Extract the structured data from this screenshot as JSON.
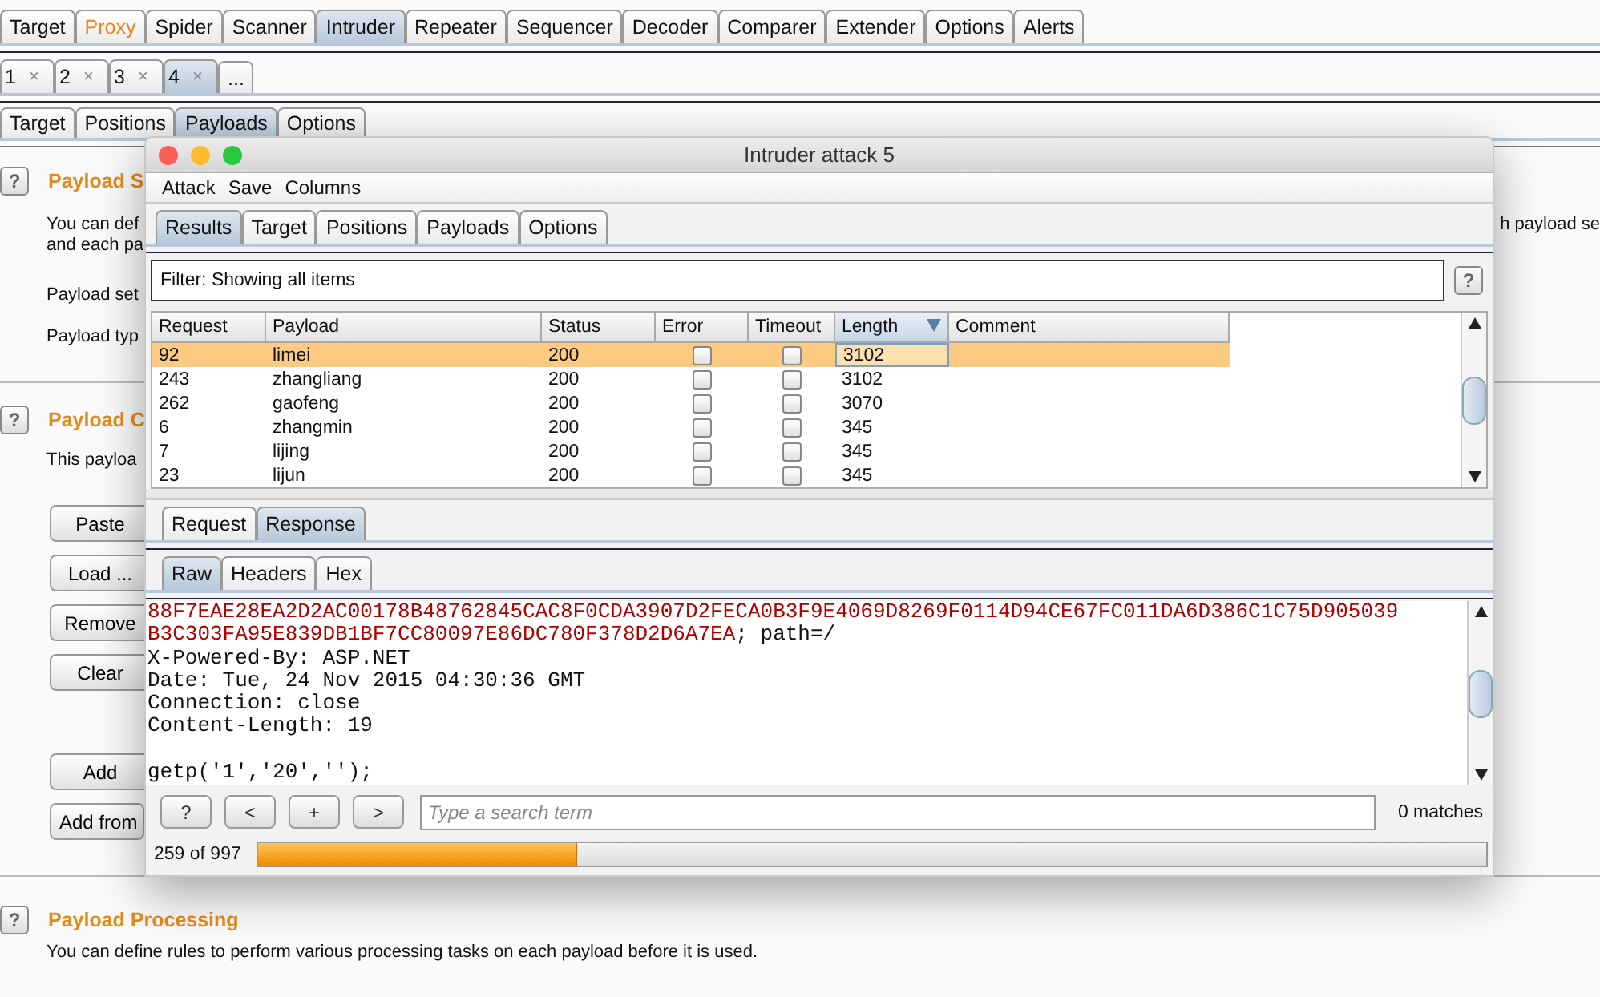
{
  "main_tabs": [
    {
      "label": "Target",
      "selected": false,
      "highlighted": false
    },
    {
      "label": "Proxy",
      "selected": false,
      "highlighted": true
    },
    {
      "label": "Spider",
      "selected": false,
      "highlighted": false
    },
    {
      "label": "Scanner",
      "selected": false,
      "highlighted": false
    },
    {
      "label": "Intruder",
      "selected": true,
      "highlighted": false
    },
    {
      "label": "Repeater",
      "selected": false,
      "highlighted": false
    },
    {
      "label": "Sequencer",
      "selected": false,
      "highlighted": false
    },
    {
      "label": "Decoder",
      "selected": false,
      "highlighted": false
    },
    {
      "label": "Comparer",
      "selected": false,
      "highlighted": false
    },
    {
      "label": "Extender",
      "selected": false,
      "highlighted": false
    },
    {
      "label": "Options",
      "selected": false,
      "highlighted": false
    },
    {
      "label": "Alerts",
      "selected": false,
      "highlighted": false
    }
  ],
  "attack_tabs": [
    {
      "label": "1",
      "close": "×",
      "selected": false
    },
    {
      "label": "2",
      "close": "×",
      "selected": false
    },
    {
      "label": "3",
      "close": "×",
      "selected": false
    },
    {
      "label": "4",
      "close": "×",
      "selected": true
    }
  ],
  "more_tab": "...",
  "config_tabs": [
    {
      "label": "Target",
      "selected": false
    },
    {
      "label": "Positions",
      "selected": false
    },
    {
      "label": "Payloads",
      "selected": true
    },
    {
      "label": "Options",
      "selected": false
    }
  ],
  "sections": [
    {
      "help": "?",
      "title": "Payload S",
      "lines": [
        "You can def",
        "and each pa"
      ],
      "right_text": "h payload se",
      "fields": [
        "Payload set",
        "Payload typ"
      ]
    },
    {
      "help": "?",
      "title": "Payload C",
      "lines": [
        "This payloa"
      ],
      "buttons": [
        "Paste",
        "Load ...",
        "Remove",
        "Clear"
      ],
      "buttons_2": [
        "Add",
        "Add from"
      ]
    },
    {
      "help": "?",
      "title": "Payload Processing",
      "lines": [
        "You can define rules to perform various processing tasks on each payload before it is used."
      ]
    }
  ],
  "attack_window": {
    "title": "Intruder attack 5",
    "menu": [
      "Attack",
      "Save",
      "Columns"
    ],
    "tabs": [
      {
        "label": "Results",
        "selected": true
      },
      {
        "label": "Target",
        "selected": false
      },
      {
        "label": "Positions",
        "selected": false
      },
      {
        "label": "Payloads",
        "selected": false
      },
      {
        "label": "Options",
        "selected": false
      }
    ],
    "filter": "Filter: Showing all items",
    "filter_help": "?",
    "table": {
      "columns": [
        {
          "label": "Request",
          "sorted": false
        },
        {
          "label": "Payload",
          "sorted": false
        },
        {
          "label": "Status",
          "sorted": false
        },
        {
          "label": "Error",
          "sorted": false
        },
        {
          "label": "Timeout",
          "sorted": false
        },
        {
          "label": "Length",
          "sorted": true
        },
        {
          "label": "Comment",
          "sorted": false
        }
      ],
      "rows": [
        {
          "request": "92",
          "payload": "limei",
          "status": "200",
          "error": false,
          "timeout": false,
          "length": "3102",
          "selected": true
        },
        {
          "request": "243",
          "payload": "zhangliang",
          "status": "200",
          "error": false,
          "timeout": false,
          "length": "3102",
          "selected": false
        },
        {
          "request": "262",
          "payload": "gaofeng",
          "status": "200",
          "error": false,
          "timeout": false,
          "length": "3070",
          "selected": false
        },
        {
          "request": "6",
          "payload": "zhangmin",
          "status": "200",
          "error": false,
          "timeout": false,
          "length": "345",
          "selected": false
        },
        {
          "request": "7",
          "payload": "lijing",
          "status": "200",
          "error": false,
          "timeout": false,
          "length": "345",
          "selected": false
        },
        {
          "request": "23",
          "payload": "lijun",
          "status": "200",
          "error": false,
          "timeout": false,
          "length": "345",
          "selected": false
        }
      ]
    },
    "message_tabs": [
      {
        "label": "Request",
        "selected": false
      },
      {
        "label": "Response",
        "selected": true
      }
    ],
    "view_tabs": [
      {
        "label": "Raw",
        "selected": true
      },
      {
        "label": "Headers",
        "selected": false
      },
      {
        "label": "Hex",
        "selected": false
      }
    ],
    "response_lines": [
      {
        "kind": "text",
        "segments": [
          {
            "text": "88F7EAE28EA2D2AC00178B48762845CAC8F0CDA3907D2FECA0B3F9E4069D8269F0114D94CE67FC011DA6D386C1C75D905039",
            "kind": "value"
          }
        ]
      },
      {
        "kind": "text",
        "segments": [
          {
            "text": "B3C303FA95E839DB1BF7CC80097E86DC780F378D2D6A7EA",
            "kind": "value"
          },
          {
            "text": "; path=/",
            "kind": "plain"
          }
        ]
      },
      {
        "kind": "text",
        "segments": [
          {
            "text": "X-Powered-By: ASP.NET",
            "kind": "plain"
          }
        ]
      },
      {
        "kind": "text",
        "segments": [
          {
            "text": "Date: Tue, 24 Nov 2015 04:30:36 GMT",
            "kind": "plain"
          }
        ]
      },
      {
        "kind": "text",
        "segments": [
          {
            "text": "Connection: close",
            "kind": "plain"
          }
        ]
      },
      {
        "kind": "text",
        "segments": [
          {
            "text": "Content-Length: 19",
            "kind": "plain"
          }
        ]
      },
      {
        "kind": "blank"
      },
      {
        "kind": "text",
        "segments": [
          {
            "text": "getp('1','20','');",
            "kind": "plain"
          }
        ]
      }
    ],
    "search": {
      "buttons": [
        "?",
        "<",
        "+",
        ">"
      ],
      "placeholder": "Type a search term",
      "matches": "0 matches"
    },
    "progress": {
      "label": "259 of 997",
      "level": 0.26
    }
  }
}
